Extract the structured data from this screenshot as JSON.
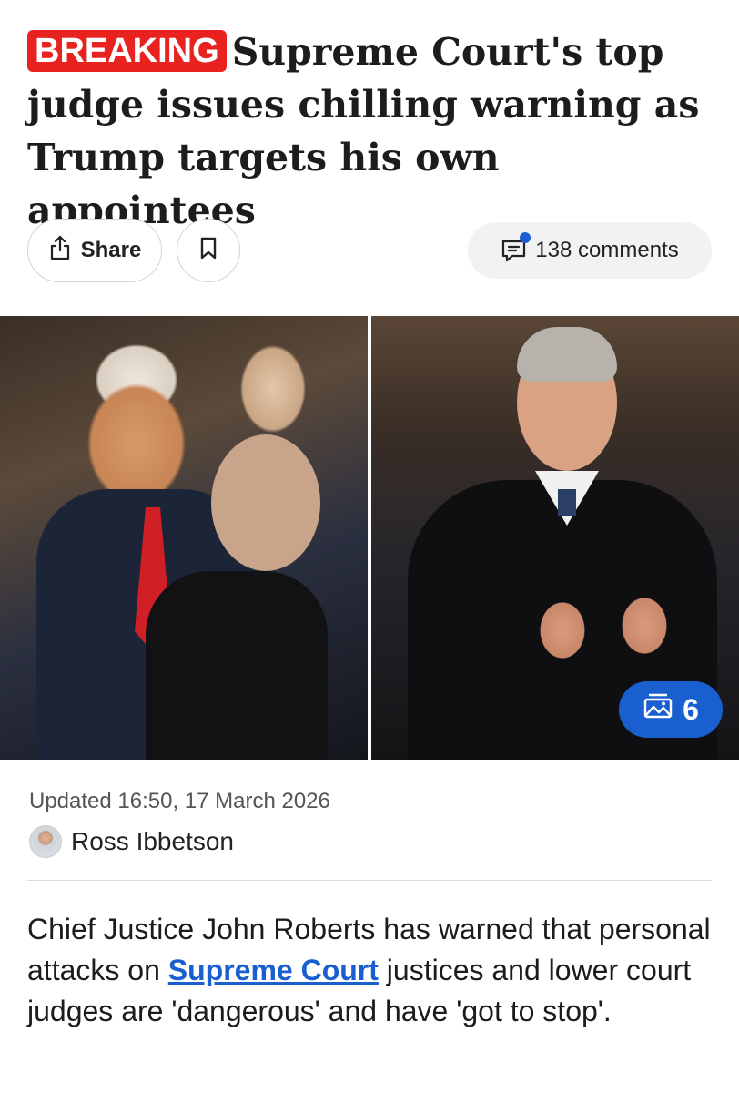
{
  "headline": {
    "badge": "BREAKING",
    "text": "Supreme Court's top judge issues chilling warning as Trump targets his own appointees"
  },
  "actions": {
    "share_label": "Share",
    "share_icon": "share-icon",
    "bookmark_icon": "bookmark-icon",
    "comments_label": "138 comments",
    "comments_icon": "comment-icon"
  },
  "gallery": {
    "count": "6",
    "icon": "gallery-icon"
  },
  "meta": {
    "updated": "Updated 16:50, 17 March 2026",
    "author": "Ross Ibbetson"
  },
  "article": {
    "intro_before": "Chief Justice John Roberts has warned that personal attacks on ",
    "intro_link": "Supreme Court",
    "intro_after": " justices and lower court judges are 'dangerous' and have 'got to stop'."
  },
  "colors": {
    "badge": "#e8231f",
    "accent": "#1a5fd0"
  }
}
